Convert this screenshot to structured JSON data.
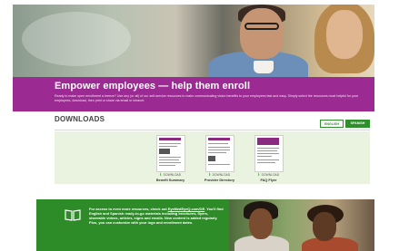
{
  "banner": {
    "title": "Empower employees — help them enroll",
    "body": "Ready to make open enrollment a breeze? Use any (or all) of our self-service resources to make communicating vision benefits to your employees fast and easy. Simply select the resources most helpful for your employees, download, then print or share via email or intranet."
  },
  "downloads": {
    "title": "DOWNLOADS",
    "languages": [
      "ENGLISH",
      "SPANISH"
    ],
    "selected_language": "SPANISH",
    "download_label": "DOWNLOAD",
    "items": [
      {
        "name": "Benefit Summary"
      },
      {
        "name": "Provider Directory"
      },
      {
        "name": "FAQ Flyer"
      }
    ]
  },
  "promo": {
    "lead": "For access to even more resources, check out",
    "link": "EyeMedEyeQ.com/OE",
    "body": ". You'll find English and Spanish ready-to-go materials including brochures, flyers, shareable videos, articles, signs and emails. New content is added regularly. Plus, you can customize with your logo and enrollment dates."
  },
  "colors": {
    "banner": "#9b2a93",
    "accent_green": "#2f8f2a",
    "panel": "#e9f3df"
  },
  "icons": [
    "download-icon",
    "book-icon"
  ]
}
